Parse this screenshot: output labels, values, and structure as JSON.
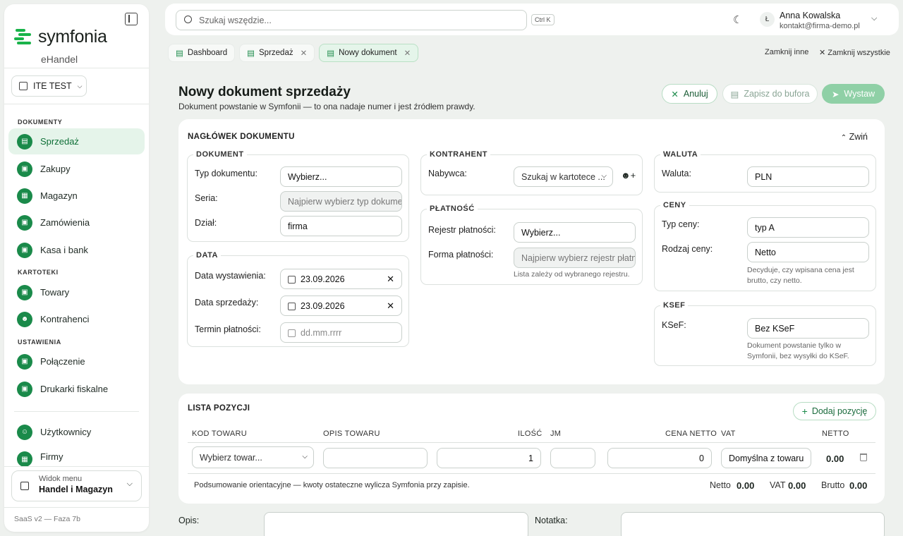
{
  "sidebar": {
    "brand": "symfonia",
    "brand_sub": "eHandel",
    "company": "ITE TEST",
    "sections": {
      "documents": "DOKUMENTY",
      "cards": "KARTOTEKI",
      "settings": "USTAWIENIA"
    },
    "items": [
      {
        "label": "Sprzedaż"
      },
      {
        "label": "Zakupy"
      },
      {
        "label": "Magazyn"
      },
      {
        "label": "Zamówienia"
      },
      {
        "label": "Kasa i bank"
      },
      {
        "label": "Towary"
      },
      {
        "label": "Kontrahenci"
      },
      {
        "label": "Połączenie"
      },
      {
        "label": "Drukarki fiskalne"
      },
      {
        "label": "Użytkownicy"
      },
      {
        "label": "Firmy"
      }
    ],
    "view_menu": {
      "label": "Widok menu",
      "value": "Handel i Magazyn"
    },
    "version": "SaaS v2 — Faza 7b"
  },
  "topbar": {
    "search_placeholder": "Szukaj wszędzie...",
    "shortcut": "Ctrl K",
    "user_initial": "Ł",
    "user_name": "Anna Kowalska",
    "user_email": "kontakt@firma-demo.pl"
  },
  "tabs": [
    {
      "label": "Dashboard"
    },
    {
      "label": "Sprzedaż"
    },
    {
      "label": "Nowy dokument"
    }
  ],
  "tab_actions": {
    "close_others": "Zamknij inne",
    "close_all": "Zamknij wszystkie"
  },
  "page": {
    "title": "Nowy dokument sprzedaży",
    "subtitle": "Dokument powstanie w Symfonii — to ona nadaje numer i jest źródłem prawdy.",
    "cancel": "Anuluj",
    "save_buffer": "Zapisz do bufora",
    "issue": "Wystaw"
  },
  "header_card": {
    "title": "NAGŁÓWEK DOKUMENTU",
    "collapse": "Zwiń",
    "document": {
      "legend": "DOKUMENT",
      "type_label": "Typ dokumentu:",
      "type_value": "Wybierz...",
      "series_label": "Seria:",
      "series_placeholder": "Najpierw wybierz typ dokumentu",
      "department_label": "Dział:",
      "department_value": "firma"
    },
    "dates": {
      "legend": "DATA",
      "issue_label": "Data wystawienia:",
      "issue_value": "23.09.2026",
      "sale_label": "Data sprzedaży:",
      "sale_value": "23.09.2026",
      "due_label": "Termin płatności:",
      "due_placeholder": "dd.mm.rrrr"
    },
    "contractor": {
      "legend": "KONTRAHENT",
      "buyer_label": "Nabywca:",
      "buyer_placeholder": "Szukaj w kartotece ..."
    },
    "payment": {
      "legend": "PŁATNOŚĆ",
      "register_label": "Rejestr płatności:",
      "register_value": "Wybierz...",
      "form_label": "Forma płatności:",
      "form_placeholder": "Najpierw wybierz rejestr płatności",
      "hint": "Lista zależy od wybranego rejestru."
    },
    "currency": {
      "legend": "WALUTA",
      "label": "Waluta:",
      "value": "PLN"
    },
    "prices": {
      "legend": "CENY",
      "type_label": "Typ ceny:",
      "type_value": "typ A",
      "kind_label": "Rodzaj ceny:",
      "kind_value": "Netto",
      "hint": "Decyduje, czy wpisana cena jest brutto, czy netto."
    },
    "ksef": {
      "legend": "KSEF",
      "label": "KSeF:",
      "value": "Bez KSeF",
      "hint": "Dokument powstanie tylko w Symfonii, bez wysyłki do KSeF."
    }
  },
  "items_card": {
    "title": "LISTA POZYCJI",
    "add": "Dodaj pozycję",
    "columns": [
      "KOD TOWARU",
      "OPIS TOWARU",
      "ILOŚĆ",
      "JM",
      "CENA NETTO",
      "VAT",
      "NETTO"
    ],
    "row": {
      "product_placeholder": "Wybierz towar...",
      "quantity": "1",
      "price": "0",
      "vat": "Domyślna z towaru",
      "net": "0.00"
    },
    "summary_note": "Podsumowanie orientacyjne — kwoty ostateczne wylicza Symfonia przy zapisie.",
    "totals": {
      "net_label": "Netto",
      "net": "0.00",
      "vat_label": "VAT",
      "vat": "0.00",
      "gross_label": "Brutto",
      "gross": "0.00"
    }
  },
  "footer_fields": {
    "description_label": "Opis:",
    "note_label": "Notatka:"
  },
  "colors": {
    "accent": "#1a8a4a",
    "accent_light": "#e5f4ea",
    "issue_button": "#8fd0a6"
  }
}
